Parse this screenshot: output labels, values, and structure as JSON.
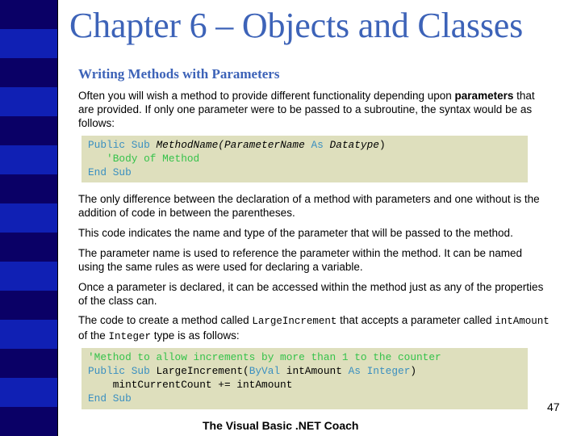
{
  "slide": {
    "title": "Chapter 6 – Objects and Classes",
    "subtitle": "Writing Methods with Parameters",
    "page_number": "47",
    "footer": "The Visual Basic .NET Coach",
    "colors": {
      "title": "#3d63b8",
      "sidebar_dark": "#0a0066",
      "sidebar_bright": "#1020b4",
      "code_background": "#dedfbd",
      "code_keyword": "#3a8fc0",
      "code_comment": "#35c24a"
    }
  },
  "paragraphs": {
    "p1_before": "Often you will wish a method to provide different functionality depending upon ",
    "p1_bold": "parameters",
    "p1_after": " that are provided. If only one parameter were to be passed to a subroutine, the syntax would be as follows:",
    "p2": "The only difference between the declaration of a method with parameters and one without is the addition of code in between the parentheses.",
    "p3": "This code indicates the name and type of the parameter that will be passed to the method.",
    "p4": "The parameter name is used to reference the parameter within the method. It can be named using the same rules as were used for declaring a variable.",
    "p5": "Once a parameter is declared, it can be accessed within the method just as any of the properties of the class can.",
    "p6_a": "The code to create a method called ",
    "p6_code1": "LargeIncrement",
    "p6_b": " that accepts a parameter called ",
    "p6_code2": "intAmount",
    "p6_c": " of the ",
    "p6_code3": "Integer",
    "p6_d": " type is as follows:"
  },
  "code1": {
    "line1": {
      "kw1": "Public Sub ",
      "name": "MethodName(ParameterName ",
      "kw2": "As",
      "type": " Datatype",
      "close": ")"
    },
    "line2": {
      "indent": "   ",
      "comment": "'Body of Method"
    },
    "line3": {
      "kw": "End Sub"
    }
  },
  "code2": {
    "line1": {
      "comment": "'Method to allow increments by more than 1 to the counter"
    },
    "line2": {
      "kw1": "Public Sub ",
      "name": "LargeIncrement(",
      "kw2": "ByVal",
      "param": " intAmount ",
      "kw3": "As Integer",
      "close": ")"
    },
    "line3": {
      "text": "    mintCurrentCount += intAmount"
    },
    "line4": {
      "kw": "End Sub"
    }
  }
}
